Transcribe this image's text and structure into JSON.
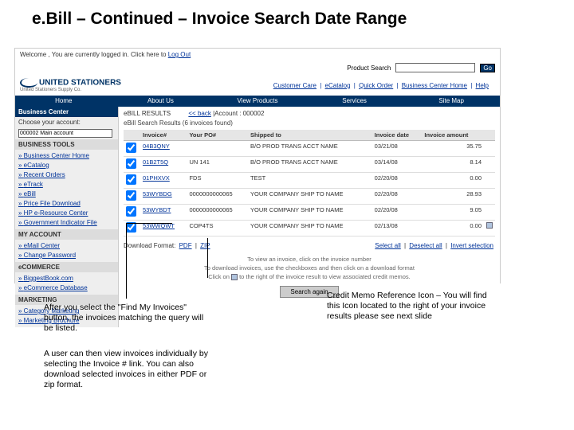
{
  "slide_title": "e.Bill – Continued – Invoice Search Date Range",
  "welcome": {
    "prefix": "Welcome , You are currently logged in.  Click here to ",
    "logout": "Log Out"
  },
  "prod_search": {
    "label": "Product Search",
    "placeholder": "",
    "go": "Go"
  },
  "top_links": [
    "Customer Care",
    "eCatalog",
    "Quick Order",
    "Business Center Home",
    "Help"
  ],
  "logo": {
    "brand": "UNITED STATIONERS",
    "sub": "United Stationers Supply Co."
  },
  "navbar": [
    "Home",
    "About Us",
    "View Products",
    "Services",
    "Site Map"
  ],
  "sidebar": {
    "hdr": "Business Center",
    "choose": "Choose your account:",
    "account": "000002 Main account",
    "tools_hdr": "BUSINESS TOOLS",
    "tools": [
      "Business Center Home",
      "eCatalog",
      "Recent Orders",
      "eTrack",
      "eBill",
      "Price File Download",
      "HP e-Resource Center",
      "Government Indicator File"
    ],
    "myacct_hdr": "MY ACCOUNT",
    "myacct": [
      "eMail Center",
      "Change Password"
    ],
    "ecom_hdr": "eCOMMERCE",
    "ecom": [
      "BiggestBook.com",
      "eCommerce Database"
    ],
    "mkt_hdr": "MARKETING",
    "mkt": [
      "Category Marketing",
      "Marketing Brochure"
    ]
  },
  "content": {
    "crumb_label": "eBILL RESULTS",
    "crumb_back": "<< back",
    "crumb_acct": "|Account : 000002",
    "results_hdr": "eBill Search Results (6 invoices found)",
    "cols": {
      "inv": "Invoice#",
      "po": "Your PO#",
      "ship": "Shipped to",
      "date": "Invoice date",
      "amt": "Invoice amount"
    },
    "rows": [
      {
        "inv": "04B3QNY",
        "po": "",
        "ship": "B/O PROD TRANS ACCT NAME",
        "date": "03/21/08",
        "amt": "35.75"
      },
      {
        "inv": "01B2T5Q",
        "po": "UN 141",
        "ship": "B/O PROD TRANS ACCT NAME",
        "date": "03/14/08",
        "amt": "8.14"
      },
      {
        "inv": "01PHXVX",
        "po": "FDS",
        "ship": "TEST",
        "date": "02/20/08",
        "amt": "0.00"
      },
      {
        "inv": "53WYBDG",
        "po": "0000000000065",
        "ship": "YOUR COMPANY SHIP TO NAME",
        "date": "02/20/08",
        "amt": "28.93"
      },
      {
        "inv": "53WYBDT",
        "po": "0000000000065",
        "ship": "YOUR COMPANY SHIP TO NAME",
        "date": "02/20/08",
        "amt": "9.05"
      },
      {
        "inv": "53WWQWT",
        "po": "COP4TS",
        "ship": "YOUR COMPANY SHIP TO NAME",
        "date": "02/13/08",
        "amt": "0.00",
        "memo": true
      }
    ],
    "dl_label": "Download Format:",
    "dl_pdf": "PDF",
    "dl_zip": "ZIP",
    "sel_all": "Select all",
    "desel_all": "Deselect all",
    "invert": "Invert selection",
    "hint1": "To view an invoice, click on the invoice number",
    "hint2": "To download invoices, use the checkboxes and then click on a download format",
    "hint3a": "Click on ",
    "hint3b": " to the right of the invoice result to view associated credit memos.",
    "search_again": "Search again"
  },
  "captions": {
    "left1": "After you select the \"Find My Invoices\" button, the invoices matching the query will be listed.",
    "left2": "A user can then view invoices individually by selecting the Invoice # link. You can also download selected invoices in either PDF or zip format.",
    "right": "Credit Memo Reference Icon – You will find this Icon located to the right of your invoice results please see next slide"
  }
}
